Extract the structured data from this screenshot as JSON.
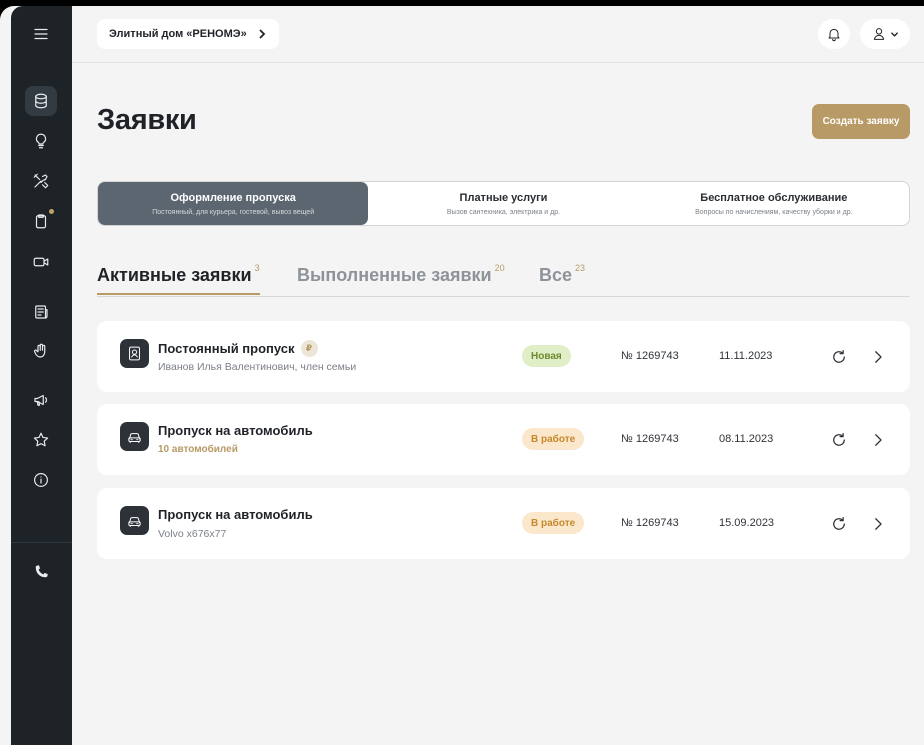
{
  "header": {
    "breadcrumb": "Элитный дом «РЕНОМЭ»"
  },
  "page": {
    "title": "Заявки",
    "create_button": "Создать заявку"
  },
  "categories": [
    {
      "title": "Оформление пропуска",
      "subtitle": "Постоянный, для курьера, гостевой, вывоз вещей",
      "active": true
    },
    {
      "title": "Платные услуги",
      "subtitle": "Вызов сантехника, электрика и др.",
      "active": false
    },
    {
      "title": "Бесплатное обслуживание",
      "subtitle": "Вопросы по начислениям, качеству уборки и др.",
      "active": false
    }
  ],
  "tabs": [
    {
      "label": "Активные заявки",
      "count": "3",
      "active": true
    },
    {
      "label": "Выполненные заявки",
      "count": "20",
      "active": false
    },
    {
      "label": "Все",
      "count": "23",
      "active": false
    }
  ],
  "requests": [
    {
      "icon": "pass-card-icon",
      "title": "Постоянный пропуск",
      "paid_marker": "₽",
      "subtitle": "Иванов Илья Валентинович, член семьи",
      "status": "Новая",
      "number": "№ 1269743",
      "date": "11.11.2023"
    },
    {
      "icon": "car-icon",
      "title": "Пропуск на автомобиль",
      "subtitle": "10 автомобилей",
      "status": "В работе",
      "number": "№ 1269743",
      "date": "08.11.2023"
    },
    {
      "icon": "car-icon",
      "title": "Пропуск на автомобиль",
      "subtitle": "Volvo x676x77",
      "status": "В работе",
      "number": "№ 1269743",
      "date": "15.09.2023"
    }
  ],
  "colors": {
    "accent": "#b89a66",
    "sidebar": "#1e2328",
    "status_new": "#e0efc8",
    "status_in_work": "#fbe8cc"
  },
  "sidebar_icons": [
    "menu-icon",
    "database-icon",
    "lightbulb-icon",
    "tools-icon",
    "clipboard-icon",
    "video-icon",
    "news-icon",
    "hand-icon",
    "megaphone-icon",
    "star-icon",
    "info-icon",
    "phone-icon"
  ]
}
